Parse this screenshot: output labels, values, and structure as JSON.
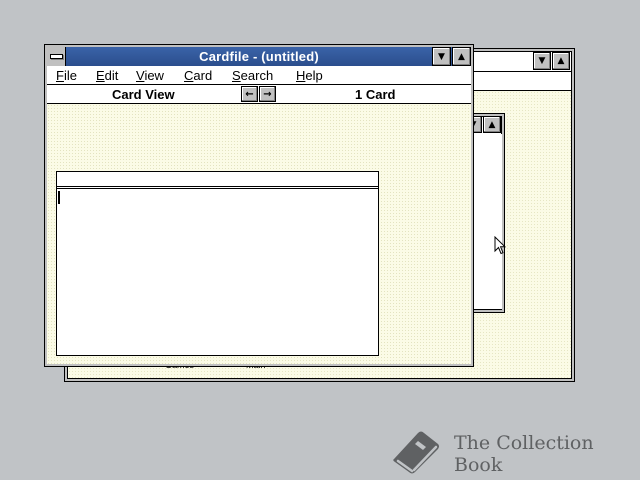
{
  "cardfile": {
    "title": "Cardfile - (untitled)",
    "menu": [
      {
        "key": "F",
        "rest": "ile"
      },
      {
        "key": "E",
        "rest": "dit"
      },
      {
        "key": "V",
        "rest": "iew"
      },
      {
        "key": "C",
        "rest": "ard"
      },
      {
        "key": "S",
        "rest": "earch"
      },
      {
        "key": "H",
        "rest": "elp"
      }
    ],
    "status": {
      "view_mode": "Card View",
      "card_count": "1 Card"
    },
    "card": {
      "index_line": "",
      "body": ""
    }
  },
  "background_window": {
    "icon_labels": [
      "Games",
      "Main"
    ]
  },
  "watermark": {
    "text": "The Collection Book"
  },
  "colors": {
    "desktop": "#c0c3c6",
    "active_title": "#2b4e8d",
    "workspace": "#fbfbe6"
  },
  "icons": {
    "system_menu": "system-menu-icon",
    "minimize": "minimize-arrow-icon",
    "maximize": "maximize-arrow-icon",
    "prev": "left-arrow-icon",
    "next": "right-arrow-icon",
    "cursor": "mouse-pointer-icon",
    "watermark": "book-icon"
  }
}
